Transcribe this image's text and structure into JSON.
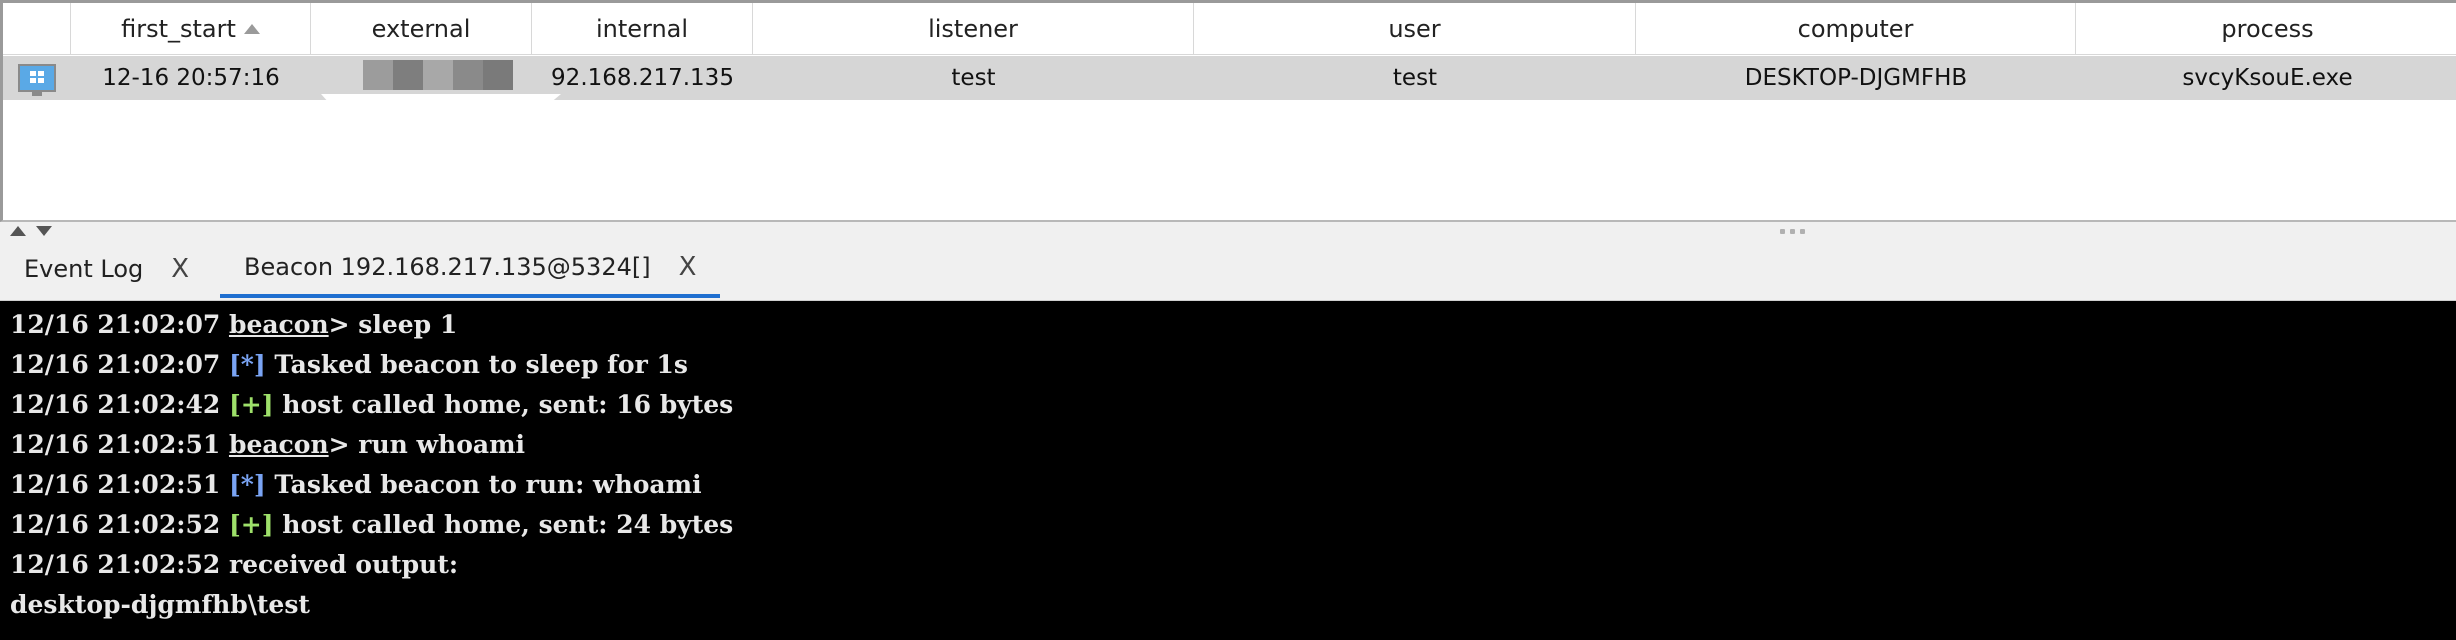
{
  "table": {
    "columns": [
      "",
      "first_start",
      "external",
      "internal",
      "listener",
      "user",
      "computer",
      "process"
    ],
    "row": {
      "icon": "windows-monitor-icon",
      "first_start": "12-16 20:57:16",
      "external": "",
      "internal": "92.168.217.135",
      "listener": "test",
      "user": "test",
      "computer": "DESKTOP-DJGMFHB",
      "process": "svcyKsouE.exe"
    }
  },
  "tabs": [
    {
      "label": "Event Log",
      "close": "X"
    },
    {
      "label": "Beacon 192.168.217.135@5324[]",
      "close": "X"
    }
  ],
  "console": {
    "lines": [
      {
        "ts": "12/16 21:02:07",
        "prompt": "beacon",
        "text": "> sleep 1"
      },
      {
        "ts": "12/16 21:02:07",
        "tag": "[*]",
        "text": " Tasked beacon to sleep for 1s"
      },
      {
        "ts": "12/16 21:02:42",
        "tag": "[+]",
        "text": " host called home, sent: 16 bytes"
      },
      {
        "ts": "12/16 21:02:51",
        "prompt": "beacon",
        "text": "> run whoami"
      },
      {
        "ts": "12/16 21:02:51",
        "tag": "[*]",
        "text": " Tasked beacon to run: whoami"
      },
      {
        "ts": "12/16 21:02:52",
        "tag": "[+]",
        "text": " host called home, sent: 24 bytes"
      },
      {
        "ts": "12/16 21:02:52",
        "text": " received output:"
      },
      {
        "text": "desktop-djgmfhb\\test"
      }
    ]
  },
  "colors": {
    "active_tab": "#1f6fd0",
    "tag_info": "#7aa4f4",
    "tag_success": "#9ee06a",
    "console_bg": "#000000",
    "row_selected": "#d6d6d6"
  }
}
